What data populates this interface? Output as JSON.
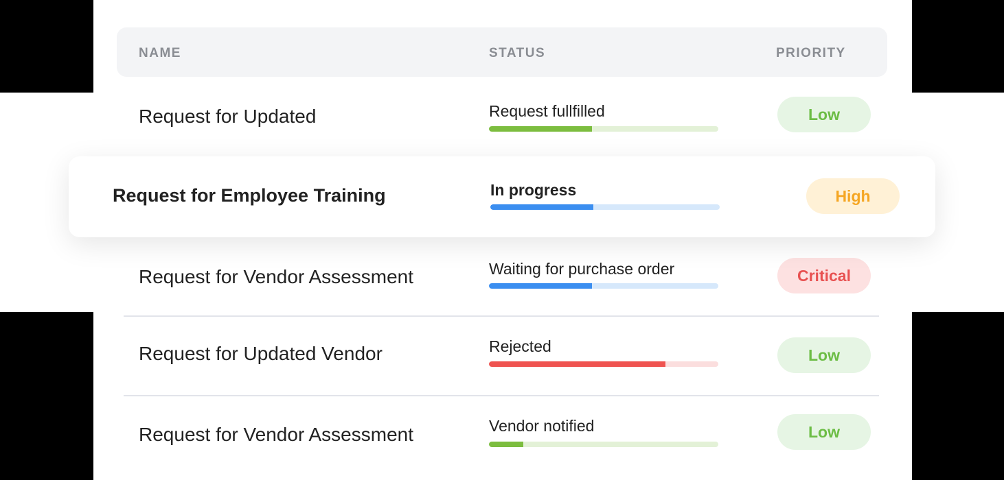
{
  "columns": {
    "name": "NAME",
    "status": "STATUS",
    "priority": "PRIORITY"
  },
  "colors": {
    "green": "#7cbd3f",
    "green_track": "#e3f1d7",
    "blue": "#3b8ef0",
    "blue_track": "#d6e8fb",
    "red": "#ef5350",
    "red_track": "#fbdede",
    "badge_low_bg": "#e6f5e4",
    "badge_low_text": "#6cbd45",
    "badge_high_bg": "#fff1d6",
    "badge_high_text": "#f5a623",
    "badge_critical_bg": "#fde1e1",
    "badge_critical_text": "#e85151"
  },
  "rows": [
    {
      "name": "Request for Updated",
      "status": "Request fullfilled",
      "progress": 0.45,
      "bar_color": "green",
      "priority": "Low"
    },
    {
      "name": "Request for Employee Training",
      "status": "In progress",
      "progress": 0.45,
      "bar_color": "blue",
      "priority": "High",
      "highlighted": true
    },
    {
      "name": "Request for Vendor Assessment",
      "status": "Waiting for purchase order",
      "progress": 0.45,
      "bar_color": "blue",
      "priority": "Critical"
    },
    {
      "name": "Request for Updated Vendor",
      "status": "Rejected",
      "progress": 0.77,
      "bar_color": "red",
      "priority": "Low"
    },
    {
      "name": "Request for Vendor Assessment",
      "status": "Vendor notified",
      "progress": 0.15,
      "bar_color": "green",
      "priority": "Low"
    }
  ]
}
